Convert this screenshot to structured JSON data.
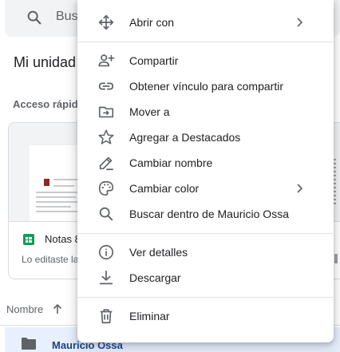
{
  "search": {
    "text": "Busc"
  },
  "page": {
    "title": "Mi unidad"
  },
  "quick_access": {
    "label": "Acceso rápid",
    "card": {
      "title": "Notas 8",
      "subtitle": "Lo editaste la"
    }
  },
  "list": {
    "sort_label": "Nombre",
    "sort_icon": "arrow-up-icon",
    "row": {
      "name": "Mauricio Ossa",
      "icon": "folder-icon"
    }
  },
  "menu": {
    "items": [
      {
        "label": "Abrir con",
        "icon": "move-arrows-icon",
        "submenu": true
      },
      {
        "label": "Compartir",
        "icon": "add-person-icon",
        "submenu": false
      },
      {
        "label": "Obtener vínculo para compartir",
        "icon": "link-icon",
        "submenu": false
      },
      {
        "label": "Mover a",
        "icon": "move-to-folder-icon",
        "submenu": false
      },
      {
        "label": "Agregar a Destacados",
        "icon": "star-icon",
        "submenu": false
      },
      {
        "label": "Cambiar nombre",
        "icon": "pencil-icon",
        "submenu": false
      },
      {
        "label": "Cambiar color",
        "icon": "palette-icon",
        "submenu": true
      },
      {
        "label": "Buscar dentro de Mauricio Ossa",
        "icon": "search-icon",
        "submenu": false
      },
      {
        "label": "Ver detalles",
        "icon": "info-icon",
        "submenu": false
      },
      {
        "label": "Descargar",
        "icon": "download-icon",
        "submenu": false
      },
      {
        "label": "Eliminar",
        "icon": "trash-icon",
        "submenu": false
      }
    ]
  },
  "colors": {
    "icon": "#5f6368",
    "text": "#202124",
    "selected_row": "#e8f0fe",
    "sheets_green": "#0f9d58"
  }
}
